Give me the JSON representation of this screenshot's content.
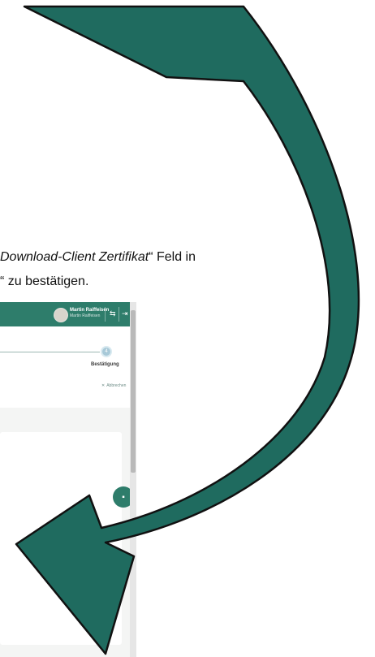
{
  "instruction": {
    "line1_emphasis": "Download-Client Zertifikat",
    "line1_rest": "“ Feld in",
    "line2": "“ zu bestätigen."
  },
  "screenshot": {
    "user_name": "Martin Raiffeisen",
    "user_subtitle": "Martin Raiffeisen",
    "cancel_label": "Abbrechen",
    "step_number": "4",
    "step_label": "Bestätigung",
    "topbar_color": "#2e7d6b"
  },
  "arrow": {
    "fill_color": "#1f6b5f",
    "stroke_color": "#111111"
  },
  "icons": {
    "swap": "swap-icon",
    "logout": "logout-icon",
    "chat": "chat-icon",
    "close": "close-icon",
    "avatar": "avatar"
  }
}
